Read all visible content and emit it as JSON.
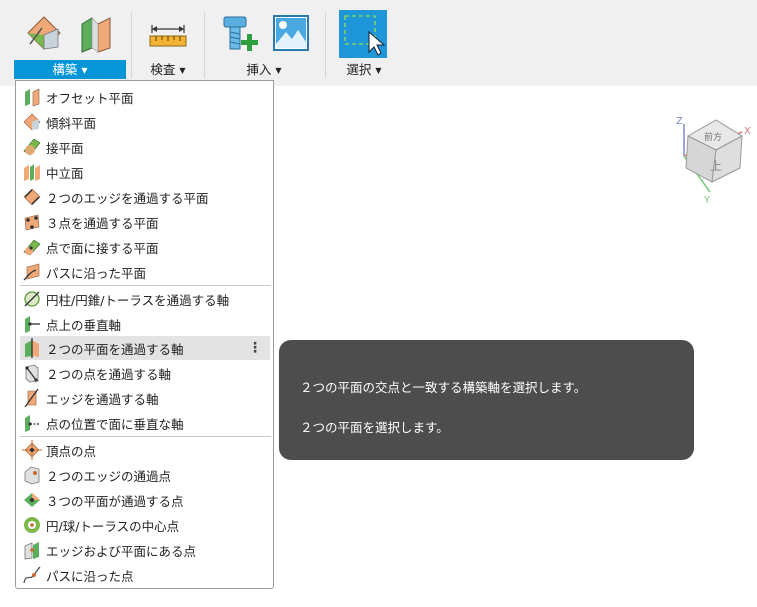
{
  "toolbar": {
    "groups": [
      {
        "label": "構築",
        "active": true
      },
      {
        "label": "検査",
        "active": false
      },
      {
        "label": "挿入",
        "active": false
      },
      {
        "label": "選択",
        "active": false
      }
    ],
    "accent_color": "#0696d7"
  },
  "menu": {
    "items": [
      {
        "label": "オフセット平面",
        "icon": "offset-plane-icon"
      },
      {
        "label": "傾斜平面",
        "icon": "plane-at-angle-icon"
      },
      {
        "label": "接平面",
        "icon": "tangent-plane-icon"
      },
      {
        "label": "中立面",
        "icon": "midplane-icon"
      },
      {
        "label": "２つのエッジを通過する平面",
        "icon": "plane-through-two-edges-icon"
      },
      {
        "label": "３点を通過する平面",
        "icon": "plane-through-three-points-icon"
      },
      {
        "label": "点で面に接する平面",
        "icon": "plane-tangent-at-point-icon"
      },
      {
        "label": "パスに沿った平面",
        "icon": "plane-along-path-icon"
      },
      {
        "label": "円柱/円錐/トーラスを通過する軸",
        "icon": "axis-through-cylinder-icon"
      },
      {
        "label": "点上の垂直軸",
        "icon": "axis-perpendicular-at-point-icon"
      },
      {
        "label": "２つの平面を通過する軸",
        "icon": "axis-through-two-planes-icon",
        "more": "⋮"
      },
      {
        "label": "２つの点を通過する軸",
        "icon": "axis-through-two-points-icon"
      },
      {
        "label": "エッジを通過する軸",
        "icon": "axis-through-edge-icon"
      },
      {
        "label": "点の位置で面に垂直な軸",
        "icon": "axis-perpendicular-to-face-icon"
      },
      {
        "label": "頂点の点",
        "icon": "point-at-vertex-icon"
      },
      {
        "label": "２つのエッジの通過点",
        "icon": "point-through-two-edges-icon"
      },
      {
        "label": "３つの平面が通過する点",
        "icon": "point-through-three-planes-icon"
      },
      {
        "label": "円/球/トーラスの中心点",
        "icon": "point-at-center-icon"
      },
      {
        "label": "エッジおよび平面にある点",
        "icon": "point-at-edge-and-plane-icon"
      },
      {
        "label": "パスに沿った点",
        "icon": "point-along-path-icon"
      }
    ]
  },
  "tooltip": {
    "line1": "２つの平面の交点と一致する構築軸を選択します。",
    "line2": "２つの平面を選択します。"
  },
  "viewcube": {
    "top_face": "前方",
    "front_face": "上",
    "axis_x": "X",
    "axis_y": "Y",
    "axis_z": "Z"
  }
}
